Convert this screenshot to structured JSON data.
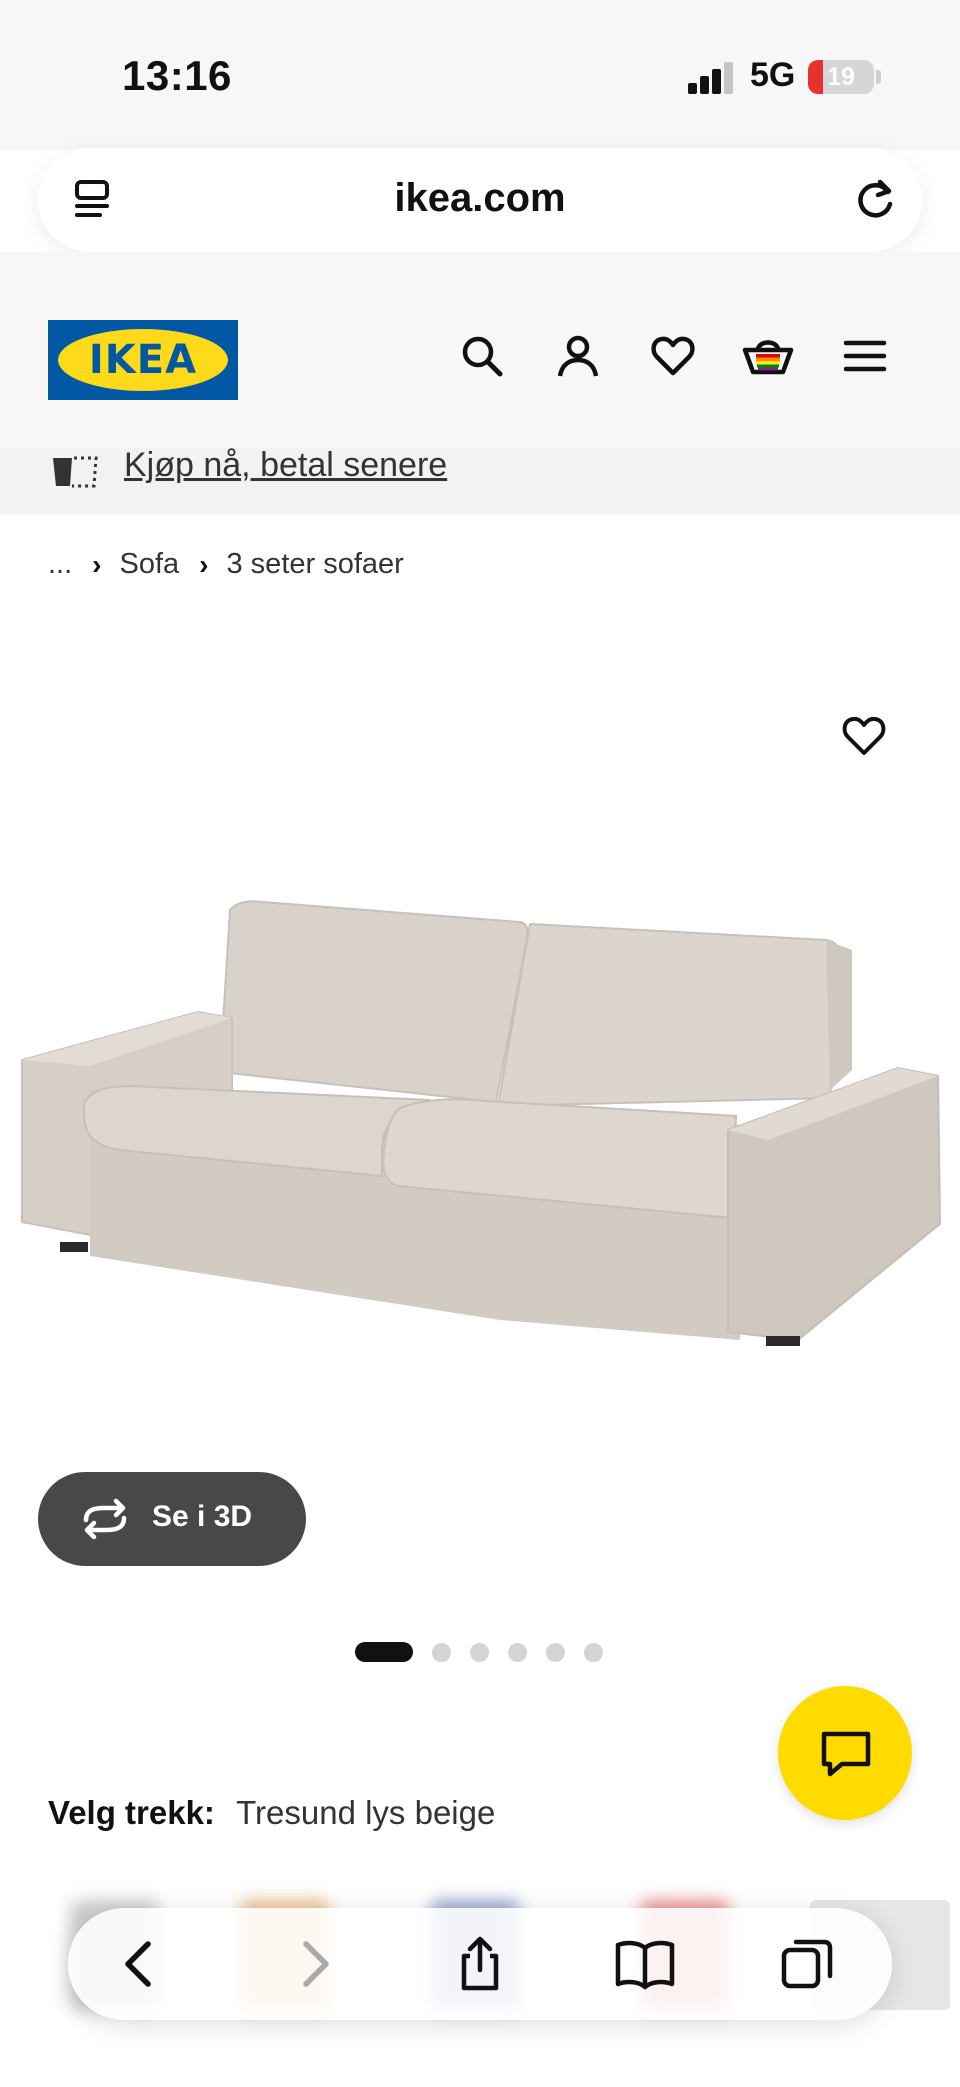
{
  "status_bar": {
    "time": "13:16",
    "network": "5G",
    "battery": "19"
  },
  "browser": {
    "url": "ikea.com"
  },
  "header": {
    "logo_text": "IKEA"
  },
  "promo": {
    "text": "Kjøp nå, betal senere"
  },
  "breadcrumb": {
    "items": [
      "...",
      "Sofa",
      "3 seter sofaer"
    ]
  },
  "product": {
    "view_3d_label": "Se i 3D",
    "gallery_count": 6,
    "gallery_active_index": 0
  },
  "cover_selection": {
    "label": "Velg trekk:",
    "value": "Tresund lys beige"
  },
  "colors": {
    "ikea_blue": "#0058a3",
    "ikea_yellow": "#ffda1a",
    "chat_yellow": "#ffdb00",
    "sofa_beige": "#d9d4cc",
    "battery_red": "#e9312f"
  },
  "icons": [
    "reader-icon",
    "reload-icon",
    "search-icon",
    "account-icon",
    "heart-icon",
    "cart-icon",
    "menu-icon",
    "rotate-3d-icon",
    "chat-icon",
    "back-icon",
    "forward-icon",
    "share-icon",
    "bookmarks-icon",
    "tabs-icon"
  ]
}
